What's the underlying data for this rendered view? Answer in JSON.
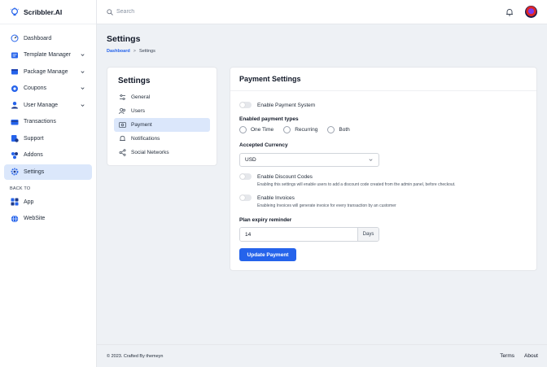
{
  "brand": {
    "name": "Scribbler.AI"
  },
  "search": {
    "placeholder": "Search"
  },
  "sidebar": {
    "items": [
      {
        "label": "Dashboard",
        "icon": "gauge-icon"
      },
      {
        "label": "Template Manager",
        "icon": "template-icon",
        "expandable": true
      },
      {
        "label": "Package Manage",
        "icon": "package-icon",
        "expandable": true
      },
      {
        "label": "Coupons",
        "icon": "coupon-icon",
        "expandable": true
      },
      {
        "label": "User Manage",
        "icon": "user-icon",
        "expandable": true
      },
      {
        "label": "Transactions",
        "icon": "card-icon"
      },
      {
        "label": "Support",
        "icon": "support-icon"
      },
      {
        "label": "Addons",
        "icon": "addons-icon"
      },
      {
        "label": "Settings",
        "icon": "gear-icon",
        "active": true
      }
    ],
    "back_to": "BACK TO",
    "back_items": [
      {
        "label": "App",
        "icon": "grid-icon"
      },
      {
        "label": "WebSite",
        "icon": "globe-icon"
      }
    ]
  },
  "page": {
    "title": "Settings",
    "breadcrumb": {
      "home": "Dashboard",
      "sep": ">",
      "current": "Settings"
    }
  },
  "settings_menu": {
    "title": "Settings",
    "items": [
      {
        "label": "General",
        "icon": "sliders-icon"
      },
      {
        "label": "Users",
        "icon": "users-icon"
      },
      {
        "label": "Payment",
        "icon": "payment-icon",
        "active": true
      },
      {
        "label": "Notifications",
        "icon": "bell-icon"
      },
      {
        "label": "Social Networks",
        "icon": "share-icon"
      }
    ]
  },
  "payment": {
    "title": "Payment Settings",
    "enable_payment_label": "Enable Payment System",
    "enable_payment_on": false,
    "types_label": "Enabled payment types",
    "types": [
      "One Time",
      "Recurring",
      "Both"
    ],
    "currency_label": "Accepted Currency",
    "currency_value": "USD",
    "discount_label": "Enable Discount Codes",
    "discount_hint": "Enabling this settings will enable users to add a discount code created from the admin panel, before checkout.",
    "invoices_label": "Enable Invoices",
    "invoices_hint": "Enableing Invoices will generate invoice for every transaction by an customer",
    "expiry_label": "Plan expiry reminder",
    "expiry_value": "14",
    "expiry_unit": "Days",
    "submit_label": "Update Payment"
  },
  "footer": {
    "copyright": "© 2023. Crafted By themeyn",
    "links": [
      "Terms",
      "About"
    ]
  },
  "colors": {
    "accent": "#2563eb",
    "active_bg": "#dbe7fb",
    "page_bg": "#eef1f5"
  }
}
